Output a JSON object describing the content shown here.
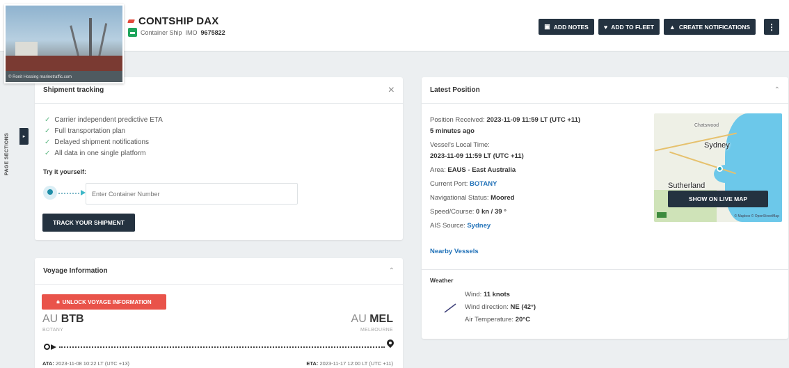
{
  "header": {
    "vessel_name": "CONTSHIP DAX",
    "vessel_type": "Container Ship",
    "imo_label": "IMO",
    "imo_number": "9675822",
    "photo_credit": "© Ronit Hossing marinetraffic.com",
    "buttons": {
      "add_notes": "ADD NOTES",
      "add_to_fleet": "ADD TO FLEET",
      "create_notifications": "CREATE NOTIFICATIONS"
    }
  },
  "page_sections": {
    "label": "PAGE SECTIONS"
  },
  "shipment_tracking": {
    "title": "Shipment tracking",
    "features": [
      "Carrier independent predictive ETA",
      "Full transportation plan",
      "Delayed shipment notifications",
      "All data in one single platform"
    ],
    "try_label": "Try it yourself:",
    "input_placeholder": "Enter Container Number",
    "button": "TRACK YOUR SHIPMENT"
  },
  "voyage": {
    "title": "Voyage Information",
    "unlock_button": "UNLOCK VOYAGE INFORMATION",
    "from": {
      "country": "AU",
      "code": "BTB",
      "name": "BOTANY"
    },
    "to": {
      "country": "AU",
      "code": "MEL",
      "name": "MELBOURNE"
    },
    "ata_label": "ATA:",
    "ata_value": "2023-11-08 10:22 LT (UTC +13)",
    "eta_label": "ETA:",
    "eta_value": "2023-11-17 12:00 LT (UTC +11)"
  },
  "latest_position": {
    "title": "Latest Position",
    "position_received_label": "Position Received:",
    "position_received_value": "2023-11-09 11:59 LT (UTC +11)",
    "position_age": "5 minutes ago",
    "local_time_label": "Vessel's Local Time:",
    "local_time_value": "2023-11-09 11:59 LT (UTC +11)",
    "area_label": "Area:",
    "area_value": "EAUS - East Australia",
    "current_port_label": "Current Port:",
    "current_port_value": "BOTANY",
    "nav_status_label": "Navigational Status:",
    "nav_status_value": "Moored",
    "speed_label": "Speed/Course:",
    "speed_value": "0 kn / 39 °",
    "ais_label": "AIS Source:",
    "ais_value": "Sydney",
    "nearby_link": "Nearby Vessels",
    "map": {
      "labels": {
        "chatswood": "Chatswood",
        "sydney": "Sydney",
        "sutherland": "Sutherland"
      },
      "button": "SHOW ON LIVE MAP",
      "credit": "© Mapbox © OpenStreetMap"
    },
    "weather": {
      "title": "Weather",
      "wind_label": "Wind:",
      "wind_value": "11 knots",
      "direction_label": "Wind direction:",
      "direction_value": "NE (42°)",
      "temp_label": "Air Temperature:",
      "temp_value": "20°C"
    }
  },
  "colors": {
    "dark_button": "#243240",
    "unlock_red": "#e9534a",
    "link_blue": "#2373b9",
    "check_green": "#5fb884",
    "type_icon_green": "#1fa55c",
    "sea_blue": "#6cc8ea"
  }
}
